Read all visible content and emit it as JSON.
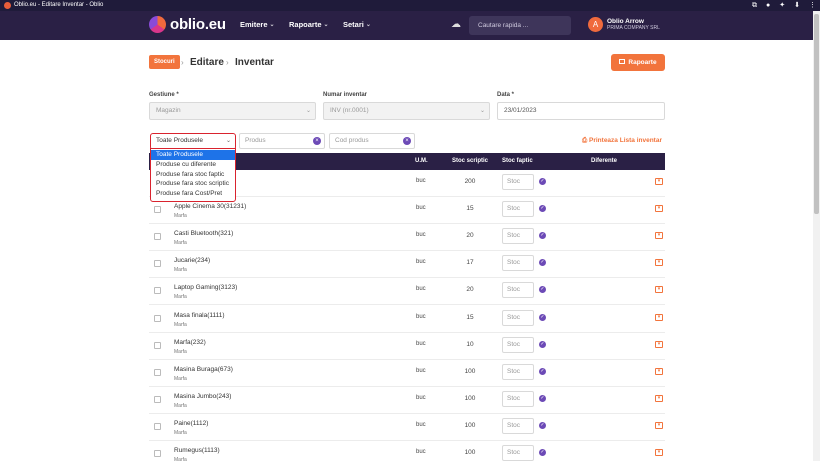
{
  "browser": {
    "title": "Oblio.eu - Editare Inventar - Oblio"
  },
  "header": {
    "logo": "oblio.eu",
    "nav": [
      {
        "label": "Emitere"
      },
      {
        "label": "Rapoarte"
      },
      {
        "label": "Setari"
      }
    ],
    "search_placeholder": "Cautare rapida ...",
    "user_initial": "A",
    "user_name": "Oblio Arrow",
    "user_company": "PRIMA COMPANY SRL"
  },
  "breadcrumb": {
    "section": "Stocuri",
    "page": "Editare",
    "current": "Inventar"
  },
  "reports_button": "Rapoarte",
  "form": {
    "gestiune_label": "Gestiune *",
    "gestiune_value": "Magazin",
    "numar_label": "Numar inventar",
    "numar_value": "INV (nr.0001)",
    "data_label": "Data *",
    "data_value": "23/01/2023"
  },
  "filters": {
    "selected": "Toate Produsele",
    "options": [
      "Toate Produsele",
      "Produse cu diferente",
      "Produse fara stoc faptic",
      "Produse fara stoc scriptic",
      "Produse fara Cost/Pret"
    ],
    "produs_placeholder": "Produs",
    "cod_placeholder": "Cod produs",
    "print_label": "Printeaza Lista inventar"
  },
  "table": {
    "columns": {
      "um": "U.M.",
      "scriptic": "Stoc scriptic",
      "faptic": "Stoc faptic",
      "diferente": "Diferente"
    },
    "stoc_placeholder": "Stoc",
    "rows": [
      {
        "name": "",
        "category": "",
        "um": "buc",
        "scriptic": "200"
      },
      {
        "name": "Apple Cinema 30(31231)",
        "category": "Marfa",
        "um": "buc",
        "scriptic": "15"
      },
      {
        "name": "Casti Bluetooth(321)",
        "category": "Marfa",
        "um": "buc",
        "scriptic": "20"
      },
      {
        "name": "Jucarie(234)",
        "category": "Marfa",
        "um": "buc",
        "scriptic": "17"
      },
      {
        "name": "Laptop Gaming(3123)",
        "category": "Marfa",
        "um": "buc",
        "scriptic": "20"
      },
      {
        "name": "Masa finala(1111)",
        "category": "Marfa",
        "um": "buc",
        "scriptic": "15"
      },
      {
        "name": "Marfa(232)",
        "category": "Marfa",
        "um": "buc",
        "scriptic": "10"
      },
      {
        "name": "Masina Buraga(673)",
        "category": "Marfa",
        "um": "buc",
        "scriptic": "100"
      },
      {
        "name": "Masina Jumbo(243)",
        "category": "Marfa",
        "um": "buc",
        "scriptic": "100"
      },
      {
        "name": "Paine(1112)",
        "category": "Marfa",
        "um": "buc",
        "scriptic": "100"
      },
      {
        "name": "Rumegus(1113)",
        "category": "Marfa",
        "um": "buc",
        "scriptic": "100"
      }
    ]
  },
  "colors": {
    "brand_dark": "#2a2045",
    "accent": "#f2743c",
    "purple": "#6c4ab6",
    "highlight": "#d9232e"
  }
}
